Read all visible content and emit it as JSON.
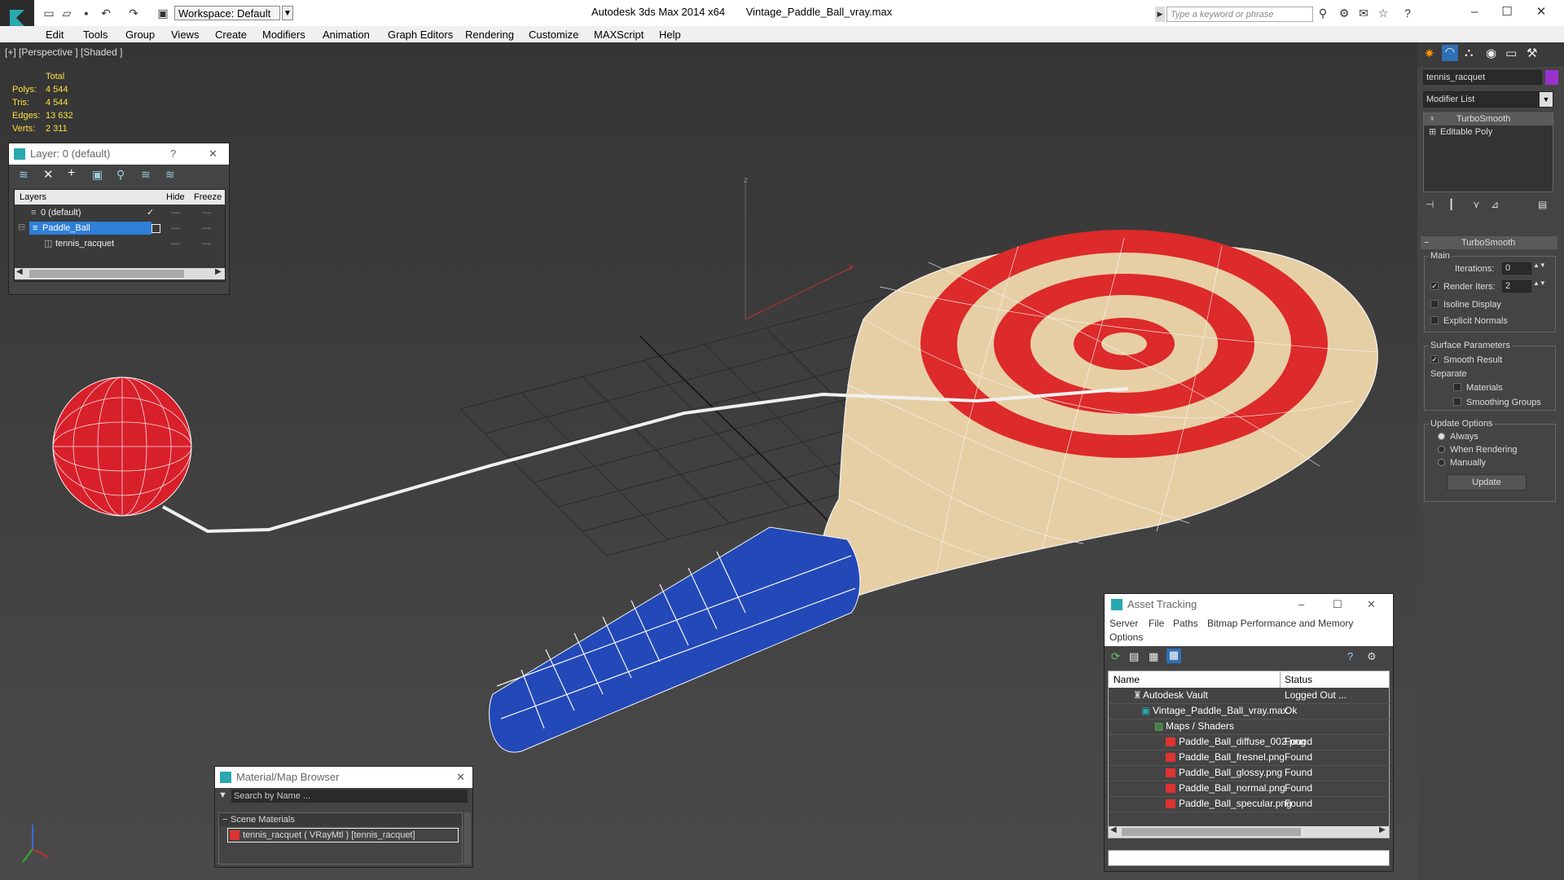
{
  "titlebar": {
    "workspace": "Workspace: Default",
    "app": "Autodesk 3ds Max  2014 x64",
    "file": "Vintage_Paddle_Ball_vray.max",
    "search_placeholder": "Type a keyword or phrase"
  },
  "menu": [
    "Edit",
    "Tools",
    "Group",
    "Views",
    "Create",
    "Modifiers",
    "Animation",
    "Graph Editors",
    "Rendering",
    "Customize",
    "MAXScript",
    "Help"
  ],
  "viewport": {
    "label": "[+] [Perspective ] [Shaded ]",
    "axis_z": "z",
    "axis_y": "y",
    "stats": {
      "header": "Total",
      "rows": [
        {
          "label": "Polys:",
          "value": "4 544"
        },
        {
          "label": "Tris:",
          "value": "4 544"
        },
        {
          "label": "Edges:",
          "value": "13 632"
        },
        {
          "label": "Verts:",
          "value": "2 311"
        }
      ]
    }
  },
  "layer_panel": {
    "title": "Layer: 0 (default)",
    "help": "?",
    "col_layers": "Layers",
    "col_hide": "Hide",
    "col_freeze": "Freeze",
    "rows": [
      "0 (default)",
      "Paddle_Ball",
      "tennis_racquet"
    ]
  },
  "command_panel": {
    "object_name": "tennis_racquet",
    "object_color": "#9933cc",
    "modifier_list": "Modifier List",
    "stack": [
      "TurboSmooth",
      "Editable Poly"
    ],
    "rollout_title": "TurboSmooth",
    "main_label": "Main",
    "iterations_label": "Iterations:",
    "iterations_value": "0",
    "render_iters_label": "Render Iters:",
    "render_iters_value": "2",
    "isoline": "Isoline Display",
    "explicit": "Explicit Normals",
    "surface_params": "Surface Parameters",
    "smooth_result": "Smooth Result",
    "separate": "Separate",
    "materials": "Materials",
    "smoothing_groups": "Smoothing Groups",
    "update_options": "Update Options",
    "always": "Always",
    "when_rendering": "When Rendering",
    "manually": "Manually",
    "update_btn": "Update"
  },
  "asset_panel": {
    "title": "Asset Tracking",
    "menus": [
      "Server",
      "File",
      "Paths",
      "Bitmap Performance and Memory",
      "Options"
    ],
    "col_name": "Name",
    "col_status": "Status",
    "rows": [
      {
        "name": "Autodesk Vault",
        "status": "Logged Out ..."
      },
      {
        "name": "Vintage_Paddle_Ball_vray.max",
        "status": "Ok"
      },
      {
        "name": "Maps / Shaders",
        "status": ""
      },
      {
        "name": "Paddle_Ball_diffuse_002.png",
        "status": "Found"
      },
      {
        "name": "Paddle_Ball_fresnel.png",
        "status": "Found"
      },
      {
        "name": "Paddle_Ball_glossy.png",
        "status": "Found"
      },
      {
        "name": "Paddle_Ball_normal.png",
        "status": "Found"
      },
      {
        "name": "Paddle_Ball_specular.png",
        "status": "Found"
      }
    ]
  },
  "material_panel": {
    "title": "Material/Map Browser",
    "search_placeholder": "Search by Name ...",
    "section": "Scene Materials",
    "item": "tennis_racquet  ( VRayMtl )  [tennis_racquet]"
  }
}
